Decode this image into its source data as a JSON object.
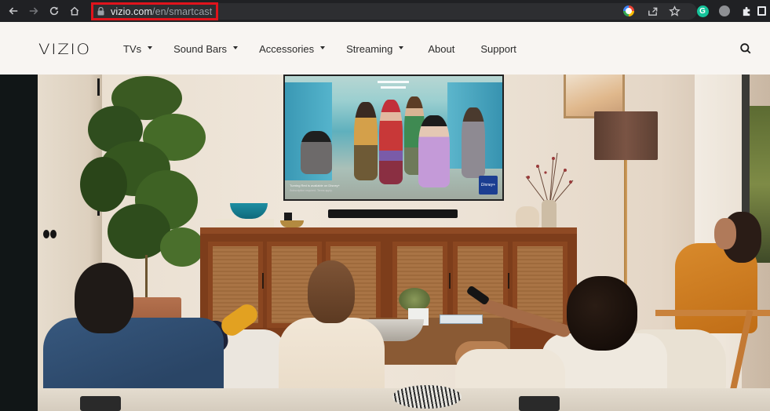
{
  "browser": {
    "url_domain": "vizio.com",
    "url_path": "/en/smartcast",
    "buttons": {
      "back": "back",
      "forward": "forward",
      "reload": "reload",
      "home": "home"
    },
    "extensions": [
      "google-lens",
      "share",
      "bookmark-star",
      "grammarly",
      "profile-globe",
      "extensions-puzzle",
      "sidebar"
    ],
    "grammarly_letter": "G"
  },
  "site": {
    "logo": "VIZIO",
    "nav": [
      {
        "label": "TVs",
        "has_dropdown": true
      },
      {
        "label": "Sound Bars",
        "has_dropdown": true
      },
      {
        "label": "Accessories",
        "has_dropdown": true
      },
      {
        "label": "Streaming",
        "has_dropdown": true
      },
      {
        "label": "About",
        "has_dropdown": false
      },
      {
        "label": "Support",
        "has_dropdown": false
      }
    ],
    "search_icon": "search-icon"
  },
  "hero": {
    "description": "Living room with family watching a VIZIO TV showing an animated film",
    "tv_caption_line1": "Turning Red is available on Disney+",
    "tv_caption_line2": "Subscription required. Terms apply.",
    "tv_badge": "Disney+"
  },
  "colors": {
    "chrome_bg": "#202124",
    "omnibox_highlight": "#e0141c",
    "header_bg": "#f8f5f2",
    "nav_text": "#2b2b2b"
  }
}
